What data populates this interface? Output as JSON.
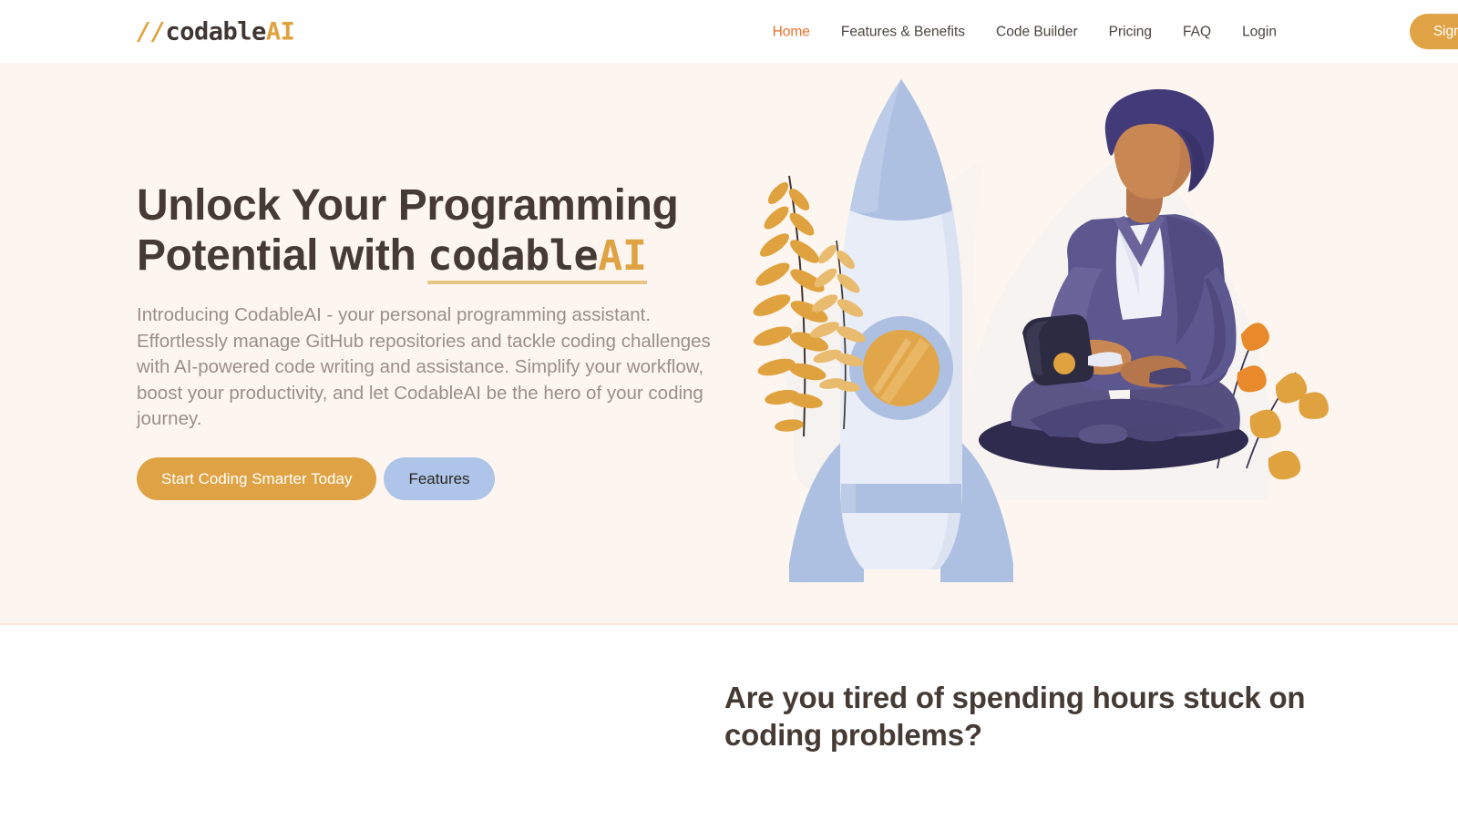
{
  "header": {
    "logo": {
      "slashes": "//",
      "word": "codable",
      "ai": "AI"
    },
    "nav": [
      {
        "label": "Home",
        "active": true
      },
      {
        "label": "Features & Benefits",
        "active": false
      },
      {
        "label": "Code Builder",
        "active": false
      },
      {
        "label": "Pricing",
        "active": false
      },
      {
        "label": "FAQ",
        "active": false
      },
      {
        "label": "Login",
        "active": false
      }
    ],
    "signup_label": "Sign Up"
  },
  "hero": {
    "title_line1": "Unlock Your Programming",
    "title_line2_prefix": "Potential with ",
    "brand_part1": "codable",
    "brand_part2": "AI",
    "subtitle": "Introducing CodableAI - your personal programming assistant. Effortlessly manage GitHub repositories and tackle coding challenges with AI-powered code writing and assistance. Simplify your workflow, boost your productivity, and let CodableAI be the hero of your coding journey.",
    "primary_cta": "Start Coding Smarter Today",
    "secondary_cta": "Features",
    "illustration_name": "rocket-and-person-illustration"
  },
  "section2": {
    "heading": "Are you tired of spending hours stuck on coding problems?"
  },
  "colors": {
    "brand_orange": "#dfa244",
    "active_nav": "#ec6f28",
    "heading_dark": "#463a34",
    "body_text": "#9c8d88",
    "hero_bg": "#fdf6f0",
    "secondary_btn": "#aec4e8",
    "underline": "#e9c684"
  }
}
